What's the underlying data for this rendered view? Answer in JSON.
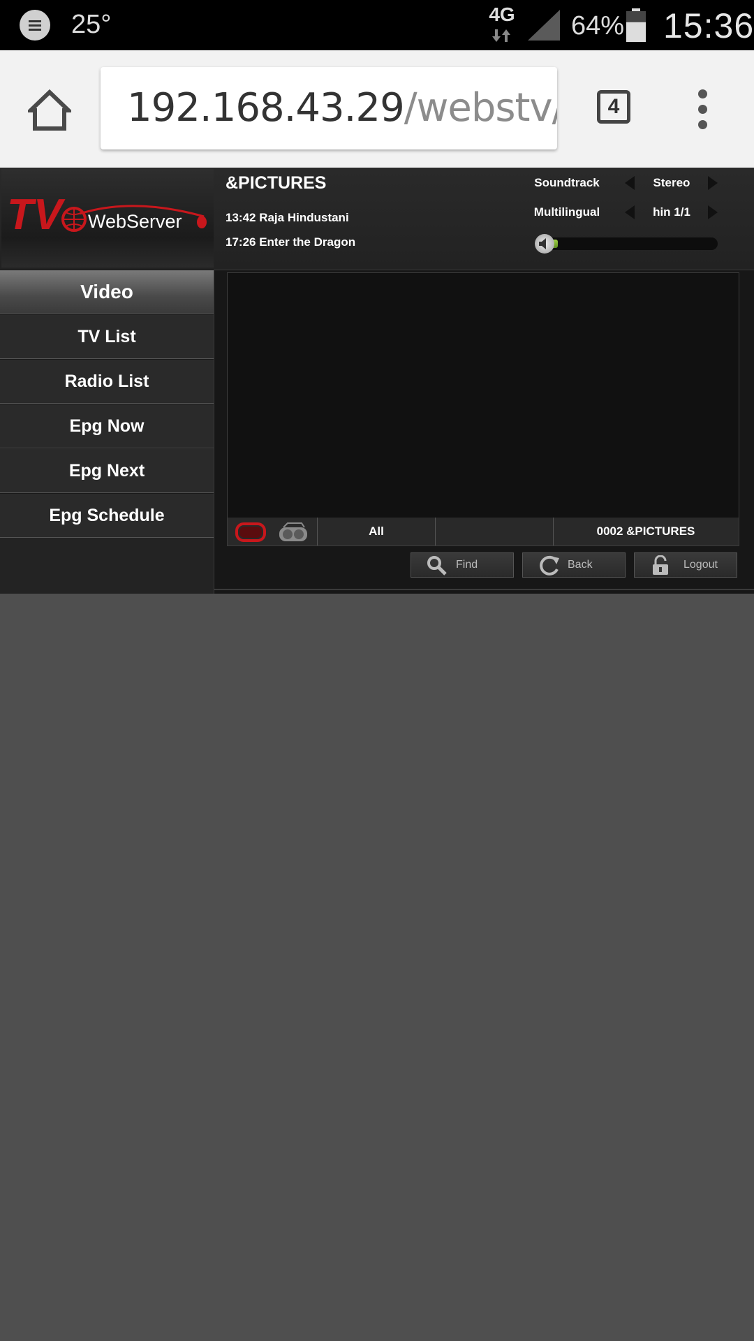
{
  "status_bar": {
    "temperature": "25°",
    "network": "4G",
    "battery_percent": "64%",
    "battery_level": 0.64,
    "time": "15:36"
  },
  "browser": {
    "url_host": "192.168.43.29",
    "url_path": "/webstv/webs",
    "tab_count": "4"
  },
  "header": {
    "channel": "&PICTURES",
    "epg_now": "13:42 Raja Hindustani",
    "epg_next": "17:26 Enter the Dragon",
    "soundtrack_label": "Soundtrack",
    "soundtrack_value": "Stereo",
    "language_label": "Multilingual",
    "language_value": "hin 1/1",
    "volume_level": 0.08
  },
  "logo": {
    "text_tv": "TV",
    "text_webserver": "WebServer"
  },
  "sidebar": {
    "items": [
      {
        "label": "Video"
      },
      {
        "label": "TV List"
      },
      {
        "label": "Radio List"
      },
      {
        "label": "Epg Now"
      },
      {
        "label": "Epg Next"
      },
      {
        "label": "Epg Schedule"
      }
    ]
  },
  "video_bar": {
    "group": "All",
    "middle": "",
    "channel_number": "0002 &PICTURES"
  },
  "buttons": {
    "find": "Find",
    "back": "Back",
    "logout": "Logout"
  },
  "icons": {
    "message": "message-icon",
    "home": "home-icon",
    "menu": "overflow-menu-icon",
    "tv": "tv-icon",
    "radio": "radio-icon",
    "search": "search-icon",
    "refresh": "refresh-icon",
    "lock": "unlock-icon",
    "speaker": "speaker-icon"
  }
}
